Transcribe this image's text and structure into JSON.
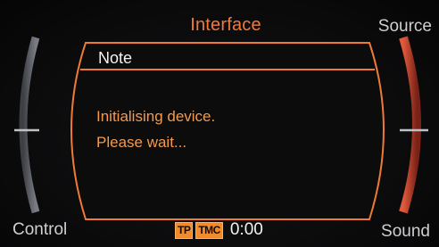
{
  "header": {
    "title": "Interface"
  },
  "corners": {
    "top_right": "Source",
    "bottom_left": "Control",
    "bottom_right": "Sound"
  },
  "dialog": {
    "title": "Note",
    "message_line1": "Initialising device.",
    "message_line2": "Please wait..."
  },
  "status_bar": {
    "tp_badge": "TP",
    "tmc_badge": "TMC",
    "clock": "0:00"
  },
  "colors": {
    "accent": "#f07a3a",
    "red_arc": "#c3412c",
    "background": "#0b0b0c"
  }
}
